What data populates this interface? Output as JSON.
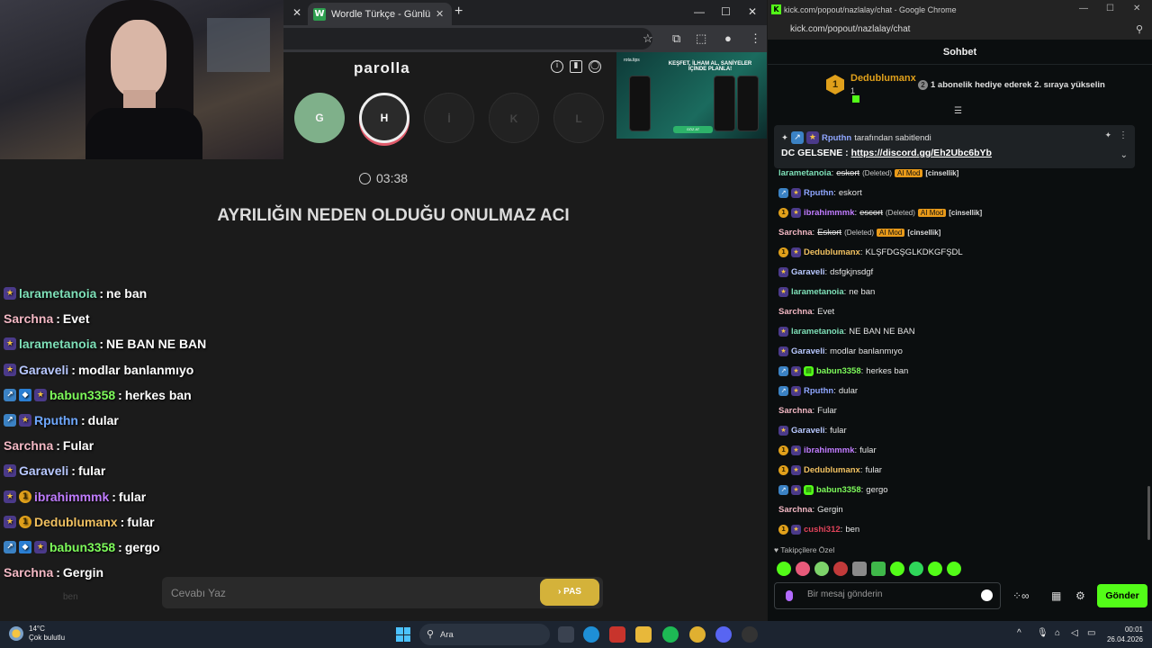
{
  "left_browser": {
    "tab_title": "Wordle Türkçe - Günlük Kelime",
    "tab_favicon": "W",
    "tab_close": "✕",
    "new_tab": "+"
  },
  "parolla": {
    "title": "parolla",
    "letters": [
      "G",
      "H",
      "İ",
      "K",
      "L"
    ],
    "timer": "03:38",
    "question": "AYRILIĞIN NEDEN OLDUĞU ONULMAZ ACI",
    "answer_placeholder": "Cevabı Yaz",
    "pas_label": "› PAS"
  },
  "ad": {
    "brand": "rota.tips",
    "headline": "KEŞFET, İLHAM AL, SANİYELER İÇİNDE PLANLA!",
    "button": "GÖZ AT"
  },
  "overlay_chat": [
    {
      "badges": [
        "star"
      ],
      "user": "larametanoia",
      "color": "#7ee0b8",
      "msg": "ne ban"
    },
    {
      "badges": [],
      "user": "Sarchna",
      "color": "#f3b8c4",
      "msg": "Evet"
    },
    {
      "badges": [
        "star"
      ],
      "user": "larametanoia",
      "color": "#7ee0b8",
      "msg": "NE BAN NE BAN"
    },
    {
      "badges": [
        "star"
      ],
      "user": "Garaveli",
      "color": "#b8c8ff",
      "msg": "modlar banlanmıyo"
    },
    {
      "badges": [
        "arrow",
        "cube",
        "star"
      ],
      "user": "babun3358",
      "color": "#7dfa5a",
      "msg": "herkes ban"
    },
    {
      "badges": [
        "arrow",
        "star"
      ],
      "user": "Rputhn",
      "color": "#6fa8ff",
      "msg": "dular"
    },
    {
      "badges": [],
      "user": "Sarchna",
      "color": "#f3b8c4",
      "msg": "Fular"
    },
    {
      "badges": [
        "star"
      ],
      "user": "Garaveli",
      "color": "#b8c8ff",
      "msg": "fular"
    },
    {
      "badges": [
        "star",
        "one"
      ],
      "user": "ibrahimmmk",
      "color": "#c07cff",
      "msg": "fular"
    },
    {
      "badges": [
        "star",
        "one"
      ],
      "user": "Dedublumanx",
      "color": "#f0c060",
      "msg": "fular"
    },
    {
      "badges": [
        "arrow",
        "cube",
        "star"
      ],
      "user": "babun3358",
      "color": "#7dfa5a",
      "msg": "gergo"
    },
    {
      "badges": [],
      "user": "Sarchna",
      "color": "#f3b8c4",
      "msg": "Gergin"
    }
  ],
  "overlay_faded": "ben",
  "right_browser": {
    "window_title": "kick.com/popout/nazlalay/chat - Google Chrome",
    "url": "kick.com/popout/nazlalay/chat",
    "panel_title": "Sohbet",
    "leader_name": "Dedublumanx",
    "leader_count": "1",
    "leader_rank": "1",
    "rank_message": "1 abonelik hediye ederek 2. sıraya yükselin",
    "rank_badge": "2",
    "pinned_by_user": "Rputhn",
    "pinned_by_text": "tarafından sabitlendi",
    "pinned_message_prefix": "DC GELSENE :",
    "pinned_link": "https://discord.gg/Eh2Ubc6bYb",
    "followers_only": "Takipçilere Özel",
    "message_placeholder": "Bir mesaj gönderin",
    "send_label": "Gönder"
  },
  "kick_chat": [
    {
      "badges": [],
      "user": "larametanoia",
      "color": "#7ee0b8",
      "msg": "eskort",
      "deleted": "(Deleted)",
      "aimod": "AI Mod",
      "tag": "[cinsellik]"
    },
    {
      "badges": [
        "arrow",
        "star"
      ],
      "user": "Rputhn",
      "color": "#8fa6ff",
      "msg": "eskort"
    },
    {
      "badges": [
        "one",
        "star"
      ],
      "user": "ibrahimmmk",
      "color": "#c07cff",
      "msg": "escort",
      "deleted": "(Deleted)",
      "aimod": "AI Mod",
      "tag": "[cinsellik]"
    },
    {
      "badges": [],
      "user": "Sarchna",
      "color": "#f3b8c4",
      "msg": "Eskort",
      "deleted": "(Deleted)",
      "aimod": "AI Mod",
      "tag": "[cinsellik]"
    },
    {
      "badges": [
        "one",
        "star"
      ],
      "user": "Dedublumanx",
      "color": "#f0c060",
      "msg": "KLŞFDGŞGLKDKGFŞDL"
    },
    {
      "badges": [
        "star"
      ],
      "user": "Garaveli",
      "color": "#b8c8ff",
      "msg": "dsfgkjnsdgf"
    },
    {
      "badges": [
        "star"
      ],
      "user": "larametanoia",
      "color": "#7ee0b8",
      "msg": "ne ban"
    },
    {
      "badges": [],
      "user": "Sarchna",
      "color": "#f3b8c4",
      "msg": "Evet"
    },
    {
      "badges": [
        "star"
      ],
      "user": "larametanoia",
      "color": "#7ee0b8",
      "msg": "NE BAN NE BAN"
    },
    {
      "badges": [
        "star"
      ],
      "user": "Garaveli",
      "color": "#b8c8ff",
      "msg": "modlar banlanmıyo"
    },
    {
      "badges": [
        "arrow",
        "star",
        "gift"
      ],
      "user": "babun3358",
      "color": "#7dfa5a",
      "msg": "herkes ban"
    },
    {
      "badges": [
        "arrow",
        "star"
      ],
      "user": "Rputhn",
      "color": "#8fa6ff",
      "msg": "dular"
    },
    {
      "badges": [],
      "user": "Sarchna",
      "color": "#f3b8c4",
      "msg": "Fular"
    },
    {
      "badges": [
        "star"
      ],
      "user": "Garaveli",
      "color": "#b8c8ff",
      "msg": "fular"
    },
    {
      "badges": [
        "one",
        "star"
      ],
      "user": "ibrahimmmk",
      "color": "#c07cff",
      "msg": "fular"
    },
    {
      "badges": [
        "one",
        "star"
      ],
      "user": "Dedublumanx",
      "color": "#f0c060",
      "msg": "fular"
    },
    {
      "badges": [
        "arrow",
        "star",
        "gift"
      ],
      "user": "babun3358",
      "color": "#7dfa5a",
      "msg": "gergo"
    },
    {
      "badges": [],
      "user": "Sarchna",
      "color": "#f3b8c4",
      "msg": "Gergin"
    },
    {
      "badges": [
        "one",
        "star"
      ],
      "user": "cushi312",
      "color": "#e0435a",
      "msg": "ben"
    }
  ],
  "taskbar": {
    "weather_temp": "14°C",
    "weather_desc": "Çok bulutlu",
    "search_label": "Ara",
    "time": "00:01",
    "date": "26.04.2026"
  },
  "colors": {
    "kick_green": "#53fc18",
    "pas_yellow": "#d4b23a",
    "gold": "#e0a01b"
  }
}
